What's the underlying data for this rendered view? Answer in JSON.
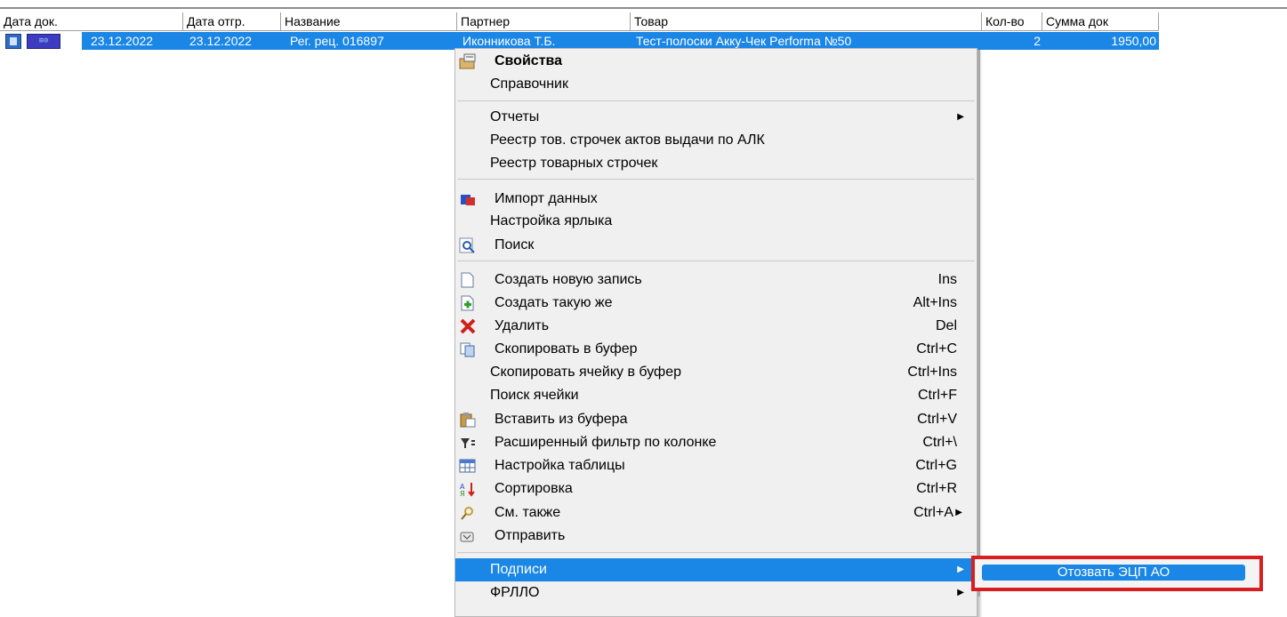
{
  "grid": {
    "columns": [
      "Дата док.",
      "Дата отгр.",
      "Название",
      "Партнер",
      "Товар",
      "Кол-во",
      "Сумма док"
    ],
    "selected_row": {
      "icon_tag": "≡⊙",
      "doc_date": "23.12.2022",
      "ship_date": "23.12.2022",
      "name": "Рег. рец. 016897",
      "partner": "Иконникова Т.Б.",
      "product": "Тест-полоски Акку-Чек Performa №50",
      "qty": "2",
      "sum": "1950,00"
    }
  },
  "context_menu": {
    "items": [
      {
        "label": "Свойства",
        "icon": "properties-icon",
        "bold": true
      },
      {
        "label": "Справочник"
      },
      {
        "label": "Отчеты",
        "submenu": true
      },
      {
        "label": "Реестр тов. строчек актов выдачи по АЛК"
      },
      {
        "label": "Реестр товарных строчек"
      },
      {
        "label": "Импорт данных",
        "icon": "import-icon"
      },
      {
        "label": "Настройка ярлыка"
      },
      {
        "label": "Поиск",
        "icon": "search-icon"
      },
      {
        "label": "Создать новую запись",
        "icon": "new-document-icon",
        "shortcut": "Ins"
      },
      {
        "label": "Создать такую же",
        "icon": "duplicate-icon",
        "shortcut": "Alt+Ins"
      },
      {
        "label": "Удалить",
        "icon": "delete-icon",
        "shortcut": "Del"
      },
      {
        "label": "Скопировать в буфер",
        "icon": "copy-icon",
        "shortcut": "Ctrl+C"
      },
      {
        "label": "Скопировать ячейку в буфер",
        "shortcut": "Ctrl+Ins"
      },
      {
        "label": "Поиск ячейки",
        "shortcut": "Ctrl+F"
      },
      {
        "label": "Вставить из буфера",
        "icon": "paste-icon",
        "shortcut": "Ctrl+V"
      },
      {
        "label": "Расширенный фильтр по колонке",
        "icon": "filter-icon",
        "shortcut": "Ctrl+\\"
      },
      {
        "label": "Настройка таблицы",
        "icon": "table-settings-icon",
        "shortcut": "Ctrl+G"
      },
      {
        "label": "Сортировка",
        "icon": "sort-icon",
        "shortcut": "Ctrl+R"
      },
      {
        "label": "См. также",
        "icon": "see-also-icon",
        "shortcut": "Ctrl+A"
      },
      {
        "label": "Отправить",
        "icon": "send-icon"
      },
      {
        "label": "Подписи",
        "submenu": true,
        "highlighted": true
      },
      {
        "label": "ФРЛЛО",
        "submenu": true
      }
    ]
  },
  "submenu": {
    "items": [
      {
        "label": "Отозвать ЭЦП АО",
        "highlighted": true
      }
    ]
  },
  "colors": {
    "selection": "#1a86e6",
    "highlight_frame": "#d81e1e",
    "menu_bg": "#f0f0f0"
  }
}
